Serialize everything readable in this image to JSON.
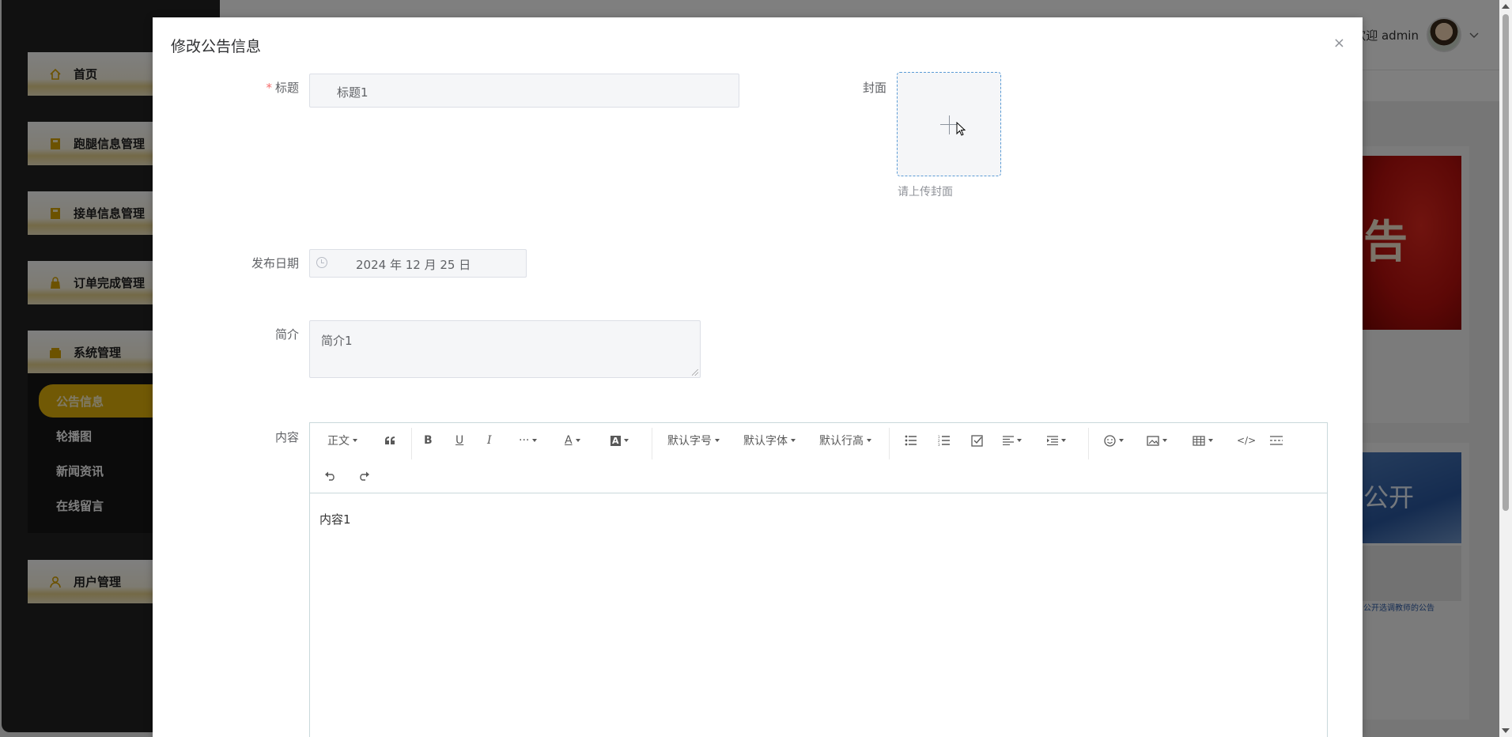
{
  "app": {
    "welcome": "欢迎 admin",
    "menu": [
      {
        "label": "首页",
        "icon": "home-icon"
      },
      {
        "label": "跑腿信息管理",
        "icon": "book-icon"
      },
      {
        "label": "接单信息管理",
        "icon": "book-icon"
      },
      {
        "label": "订单完成管理",
        "icon": "bag-icon"
      },
      {
        "label": "系统管理",
        "icon": "box-icon"
      },
      {
        "label": "用户管理",
        "icon": "user-icon"
      }
    ],
    "submenu": [
      {
        "label": "公告信息",
        "active": true
      },
      {
        "label": "轮播图"
      },
      {
        "label": "新闻资讯"
      },
      {
        "label": "在线留言"
      }
    ],
    "cards": {
      "card1_text": "告",
      "card2_text": "公开",
      "card2_caption": "公开选调教师的公告"
    }
  },
  "dialog": {
    "title": "修改公告信息",
    "close": "×",
    "fields": {
      "title_label": "标题",
      "title_required": "*",
      "title_value": "标题1",
      "cover_label": "封面",
      "cover_tip": "请上传封面",
      "date_label": "发布日期",
      "date_value": "2024 年 12 月 25 日",
      "brief_label": "简介",
      "brief_value": "简介1",
      "content_label": "内容",
      "content_value": "内容1"
    },
    "toolbar": {
      "heading": "正文",
      "font_size": "默认字号",
      "font_family": "默认字体",
      "line_height": "默认行高"
    }
  }
}
